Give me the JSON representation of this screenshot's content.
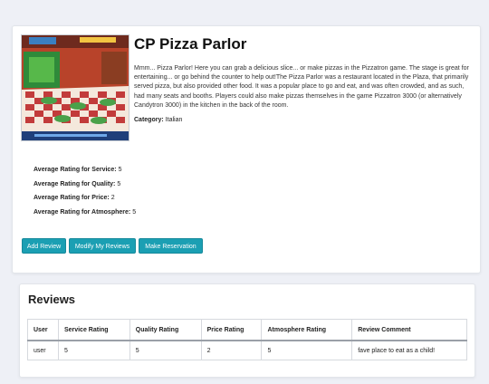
{
  "restaurant": {
    "name": "CP Pizza Parlor",
    "description": "Mmm... Pizza Parlor! Here you can grab a delicious slice... or make pizzas in the Pizzatron game. The stage is great for entertaining... or go behind the counter to help out!The Pizza Parlor was a restaurant located in the Plaza, that primarily served pizza, but also provided other food. It was a popular place to go and eat, and was often crowded, and as such, had many seats and booths. Players could also make pizzas themselves in the game Pizzatron 3000 (or alternatively Candytron 3000) in the kitchen in the back of the room.",
    "category_label": "Category:",
    "category": "Italian"
  },
  "ratings": [
    {
      "label": "Average Rating for Service:",
      "value": "5"
    },
    {
      "label": "Average Rating for Quality:",
      "value": "5"
    },
    {
      "label": "Average Rating for Price:",
      "value": "2"
    },
    {
      "label": "Average Rating for Atmosphere:",
      "value": "5"
    }
  ],
  "buttons": {
    "add_review": "Add Review",
    "modify_reviews": "Modify My Reviews",
    "make_reservation": "Make Reservation"
  },
  "reviews": {
    "title": "Reviews",
    "columns": [
      "User",
      "Service Rating",
      "Quality Rating",
      "Price Rating",
      "Atmosphere Rating",
      "Review Comment"
    ],
    "rows": [
      [
        "user",
        "5",
        "5",
        "2",
        "5",
        "fave place to eat as a child!"
      ]
    ]
  },
  "colors": {
    "button": "#1b9fb3",
    "background": "#eef0f6"
  }
}
